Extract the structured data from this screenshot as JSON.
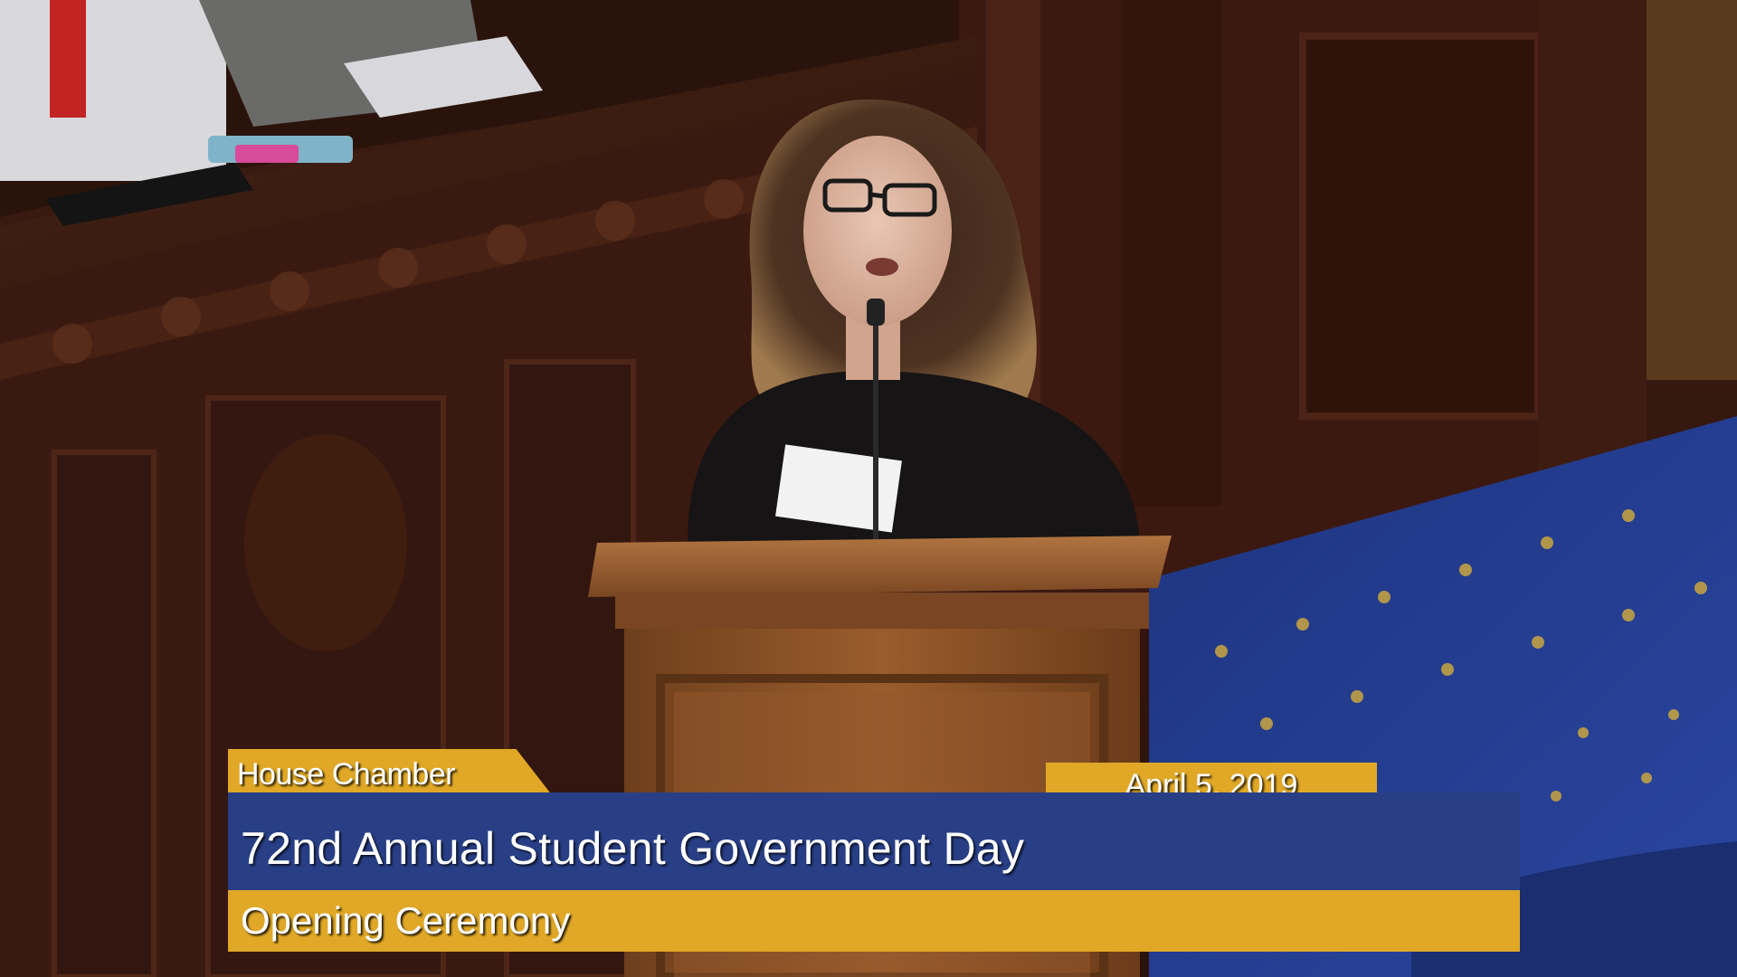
{
  "broadcast": {
    "location": "House Chamber",
    "date": "April 5, 2019",
    "title": "72nd Annual Student Government Day",
    "subtitle": "Opening Ceremony"
  },
  "colors": {
    "banner_gold": "#e0a826",
    "banner_blue": "#283f86",
    "carpet_blue": "#233a8c",
    "wood_dark": "#3a1a10",
    "podium_wood": "#8a5228"
  }
}
